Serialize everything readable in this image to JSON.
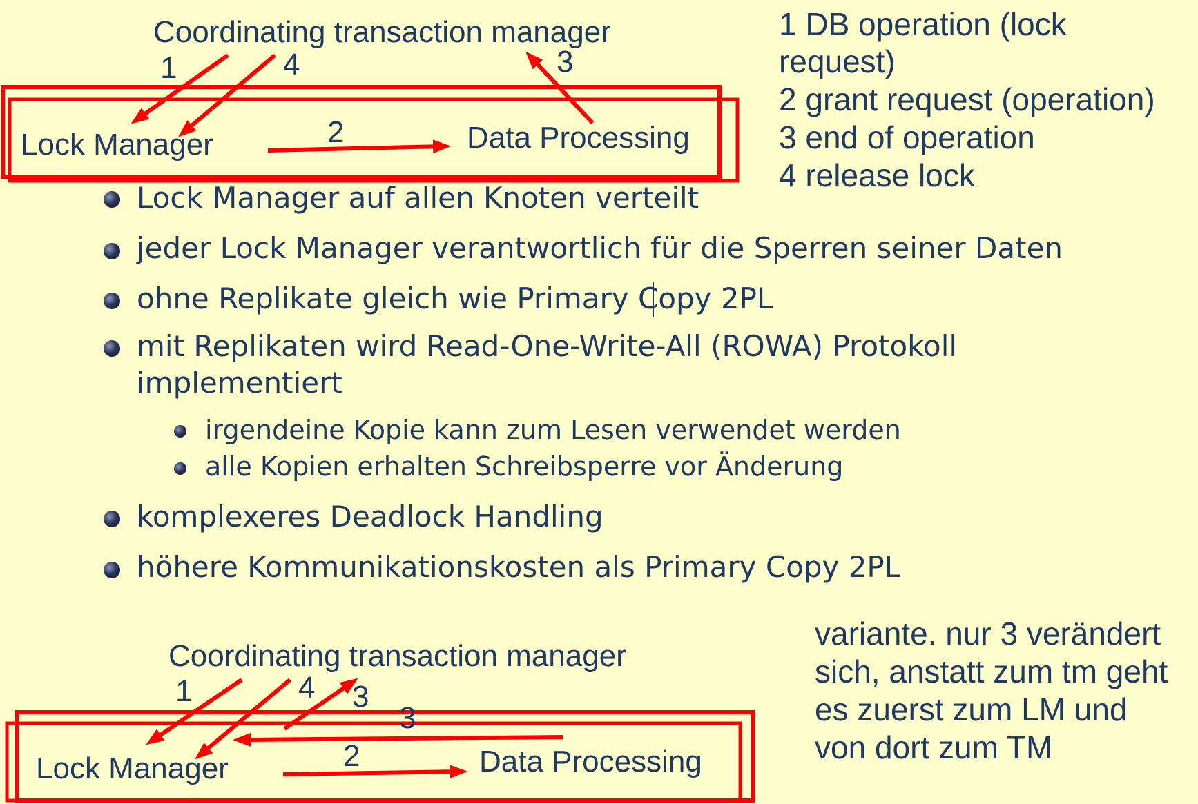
{
  "diagram_top": {
    "coordinator": "Coordinating transaction manager",
    "lock_manager": "Lock Manager",
    "data_processing": "Data Processing",
    "arrow_labels": [
      "1",
      "4",
      "3",
      "2"
    ]
  },
  "legend": {
    "lines": [
      "1 DB operation (lock",
      "request)",
      "2 grant request (operation)",
      "3 end of operation",
      "4 release lock"
    ]
  },
  "bullets": [
    "Lock Manager auf allen Knoten verteilt",
    "jeder Lock Manager verantwortlich für die Sperren seiner Daten",
    "ohne Replikate gleich wie Primary Copy 2PL",
    "mit Replikaten wird Read-One-Write-All (ROWA) Protokoll",
    "implementiert"
  ],
  "sub_bullets": [
    "irgendeine Kopie kann zum Lesen verwendet werden",
    "alle Kopien erhalten Schreibsperre vor Änderung"
  ],
  "bullets_after": [
    "komplexeres Deadlock Handling",
    "höhere Kommunikationskosten als Primary Copy 2PL"
  ],
  "diagram_bottom": {
    "coordinator": "Coordinating transaction manager",
    "lock_manager": "Lock Manager",
    "data_processing": "Data Processing",
    "arrow_labels": [
      "1",
      "4",
      "3",
      "3",
      "2"
    ]
  },
  "note": {
    "lines": [
      "variante. nur 3 verändert",
      "sich, anstatt zum tm geht",
      "es zuerst zum LM und",
      "von dort zum TM"
    ]
  },
  "colors": {
    "background": "#FFFFCC",
    "text": "#1F3864",
    "accent_red": "#FF0000"
  }
}
